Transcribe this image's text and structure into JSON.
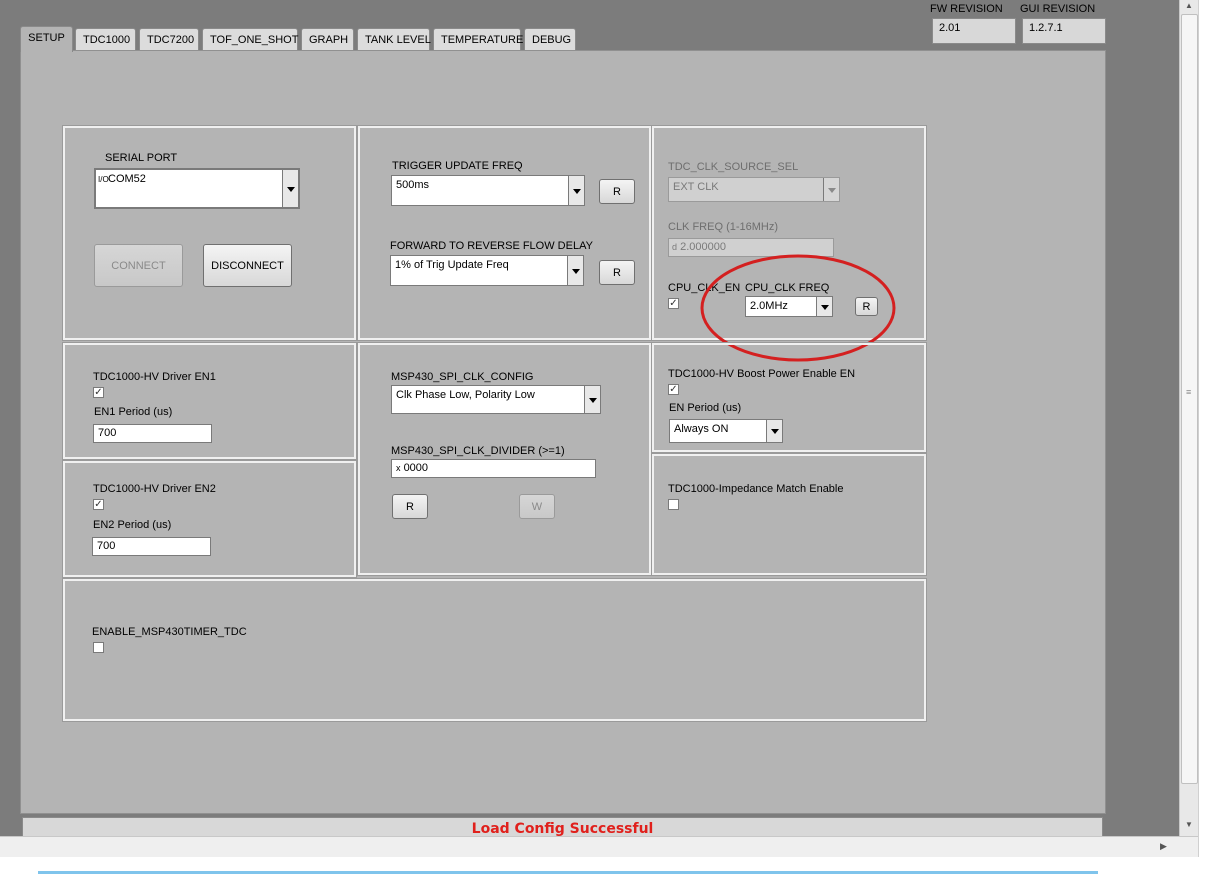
{
  "tabs": [
    "SETUP",
    "TDC1000",
    "TDC7200",
    "TOF_ONE_SHOT",
    "GRAPH",
    "TANK LEVEL",
    "TEMPERATURE",
    "DEBUG"
  ],
  "revisions": {
    "fw_label": "FW REVISION",
    "fw_value": "2.01",
    "gui_label": "GUI REVISION",
    "gui_value": "1.2.7.1"
  },
  "serial": {
    "label": "SERIAL PORT",
    "value": "COM52",
    "prefix_icon": "I/O",
    "connect": "CONNECT",
    "disconnect": "DISCONNECT"
  },
  "trigger": {
    "label": "TRIGGER UPDATE FREQ",
    "value": "500ms",
    "read": "R",
    "delay_label": "FORWARD TO REVERSE FLOW DELAY",
    "delay_value": "1% of Trig Update Freq",
    "delay_read": "R"
  },
  "clk": {
    "src_label": "TDC_CLK_SOURCE_SEL",
    "src_value": "EXT CLK",
    "freq_label": "CLK FREQ (1-16MHz)",
    "freq_prefix": "d",
    "freq_value": "2.000000",
    "cpu_en_label": "CPU_CLK_EN",
    "cpu_freq_label": "CPU_CLK FREQ",
    "cpu_freq_value": "2.0MHz",
    "cpu_read": "R"
  },
  "en1": {
    "label": "TDC1000-HV Driver EN1",
    "period_label": "EN1 Period (us)",
    "period_value": "700"
  },
  "en2": {
    "label": "TDC1000-HV Driver EN2",
    "period_label": "EN2 Period (us)",
    "period_value": "700"
  },
  "spi": {
    "config_label": "MSP430_SPI_CLK_CONFIG",
    "config_value": "Clk Phase Low, Polarity Low",
    "divider_label": "MSP430_SPI_CLK_DIVIDER (>=1)",
    "divider_prefix": "x",
    "divider_value": "0000",
    "read": "R",
    "write": "W"
  },
  "boost": {
    "label": "TDC1000-HV Boost Power Enable EN",
    "period_label": "EN Period (us)",
    "period_value": "Always ON"
  },
  "impedance": {
    "label": "TDC1000-Impedance Match Enable"
  },
  "timer": {
    "label": "ENABLE_MSP430TIMER_TDC"
  },
  "status": {
    "message": "Load Config Successful",
    "color": "#e0201c"
  },
  "accent": {
    "annotation_circle": "#d42020"
  }
}
